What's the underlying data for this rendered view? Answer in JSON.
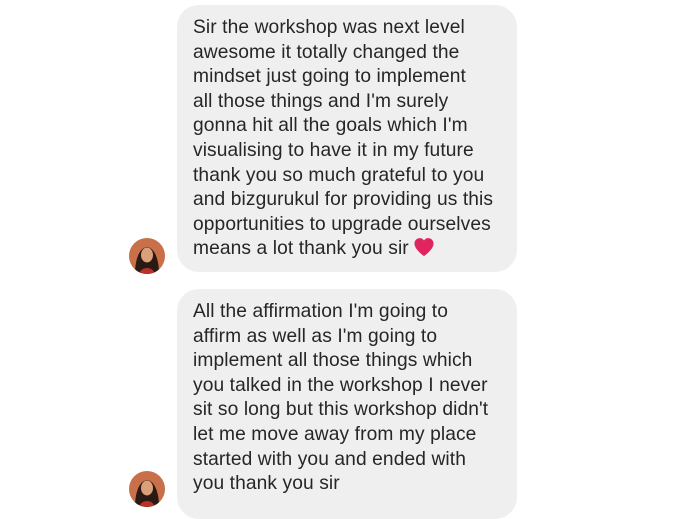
{
  "messages": [
    {
      "sender_avatar_icon": "user-avatar-icon",
      "lines": [
        "Sir the workshop was next level",
        "awesome it totally changed the",
        "mindset just going to implement",
        "all those things and I'm surely",
        "gonna hit all the goals which I'm",
        "visualising to have it in my future",
        "thank you so much grateful to you",
        "and bizgurukul for providing us this",
        "opportunities to upgrade ourselves",
        "means a lot thank you sir"
      ],
      "trailing_emoji": "red-heart-icon"
    },
    {
      "sender_avatar_icon": "user-avatar-icon",
      "lines": [
        "All the affirmation I'm going to",
        "affirm as well as I'm going to",
        "implement all those things which",
        "you talked in the workshop I never",
        "sit so long but this workshop didn't",
        "let me move away from my place",
        "started with you and ended with",
        "you thank you sir"
      ]
    }
  ],
  "colors": {
    "bubble_background": "#efefef",
    "text": "#262626",
    "heart": "#e0245e"
  }
}
